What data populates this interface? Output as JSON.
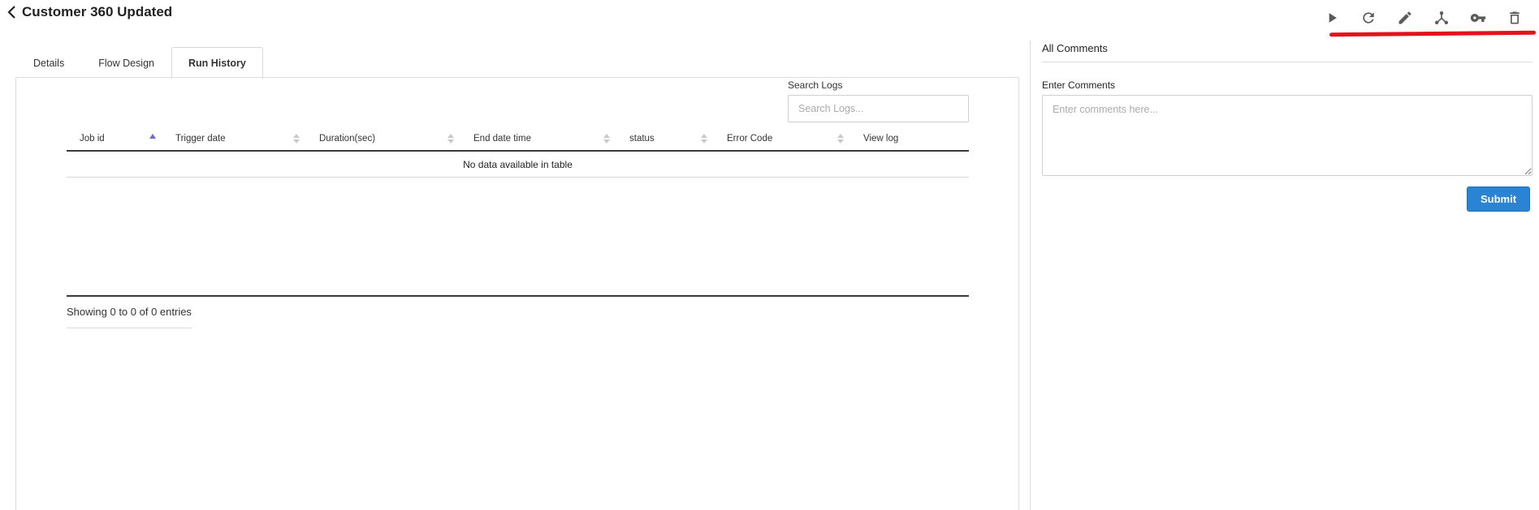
{
  "header": {
    "title": "Customer 360 Updated",
    "back_icon": "chevron-left-icon"
  },
  "toolbar": {
    "accent_color": "#e3131d",
    "buttons": [
      {
        "icon": "play-icon"
      },
      {
        "icon": "refresh-icon"
      },
      {
        "icon": "edit-icon"
      },
      {
        "icon": "merge-icon"
      },
      {
        "icon": "key-icon"
      },
      {
        "icon": "trash-icon"
      }
    ]
  },
  "tabs": [
    {
      "label": "Details",
      "active": false
    },
    {
      "label": "Flow Design",
      "active": false
    },
    {
      "label": "Run History",
      "active": true
    }
  ],
  "search": {
    "label": "Search Logs",
    "placeholder": "Search Logs..."
  },
  "table": {
    "columns": [
      "Job id",
      "Trigger date",
      "Duration(sec)",
      "End date time",
      "status",
      "Error Code",
      "View log"
    ],
    "sorted_column": "Job id",
    "sort_direction": "ascending",
    "empty_message": "No data available in table",
    "info": "Showing 0 to 0 of 0 entries"
  },
  "comments": {
    "title": "All Comments",
    "input_label": "Enter Comments",
    "placeholder": "Enter comments here...",
    "submit_label": "Submit",
    "submit_color": "#2b84d3"
  }
}
